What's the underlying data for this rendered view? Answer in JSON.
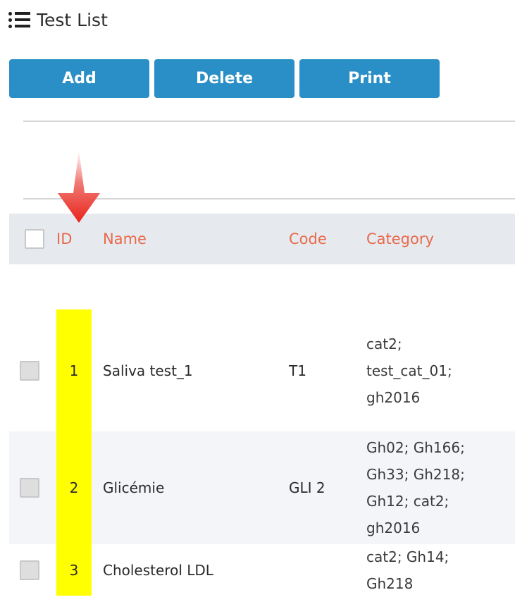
{
  "header": {
    "title": "Test List",
    "icon": "list-icon"
  },
  "toolbar": {
    "add_label": "Add",
    "delete_label": "Delete",
    "print_label": "Print"
  },
  "colors": {
    "button": "#2a8fc6",
    "header_text": "#e86a4b",
    "highlight": "#ffff00",
    "arrow": "#e8231b"
  },
  "table": {
    "columns": [
      "ID",
      "Name",
      "Code",
      "Category"
    ],
    "rows": [
      {
        "id": "1",
        "name": "Saliva test_1",
        "code": "T1",
        "category": [
          "cat2;",
          "test_cat_01;",
          "gh2016"
        ]
      },
      {
        "id": "2",
        "name": "Glicémie",
        "code": "GLI 2",
        "category": [
          "Gh02; Gh166;",
          "Gh33; Gh218;",
          "Gh12; cat2;",
          "gh2016"
        ]
      },
      {
        "id": "3",
        "name": "Cholesterol LDL",
        "code": "",
        "category": [
          "cat2; Gh14;",
          "Gh218"
        ]
      }
    ]
  }
}
